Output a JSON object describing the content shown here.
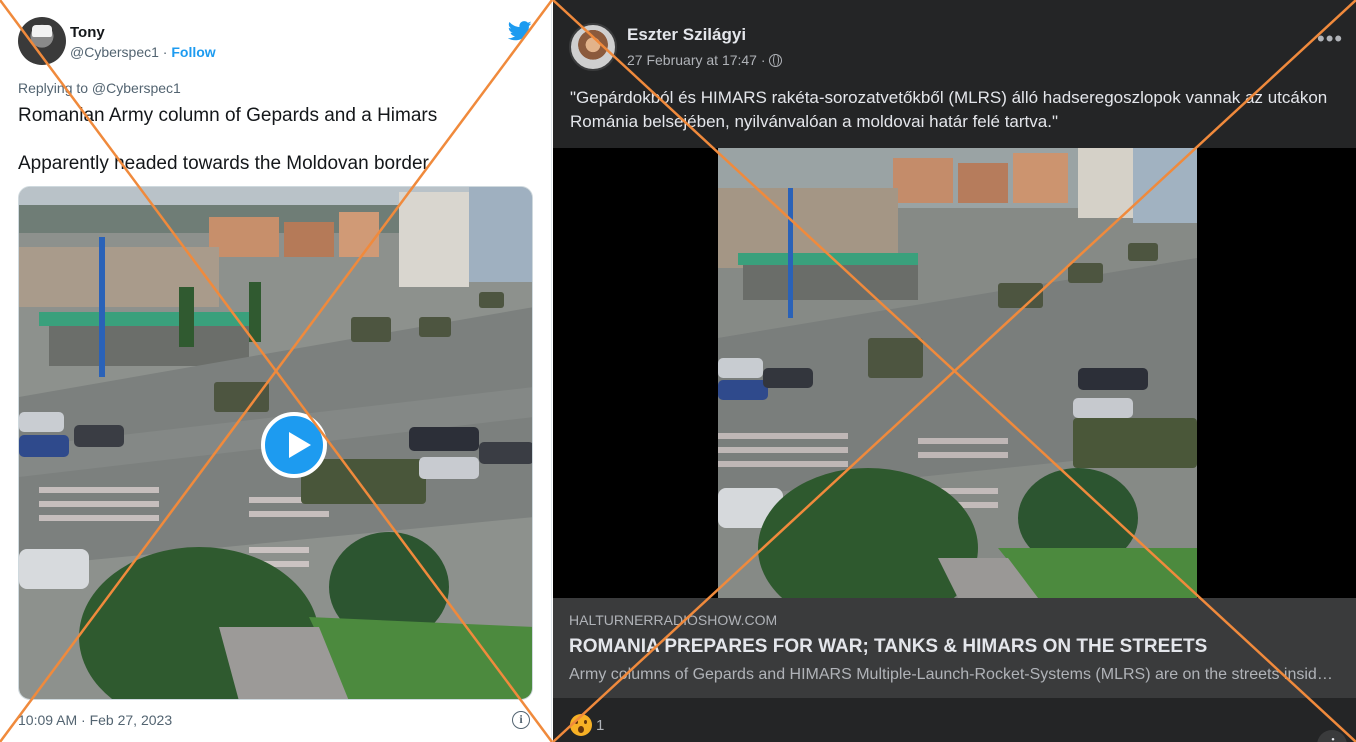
{
  "tweet": {
    "display_name": "Tony",
    "handle": "@Cyberspec1",
    "separator": " · ",
    "follow_label": "Follow",
    "replying_to": "Replying to @Cyberspec1",
    "text_line1": "Romanian Army column of Gepards and a Himars",
    "text_line2": "Apparently headed towards the Moldovan border",
    "timestamp": "10:09 AM · Feb 27, 2023",
    "icons": [
      "twitter-bird-icon",
      "play-icon",
      "info-icon"
    ]
  },
  "facebook": {
    "author": "Eszter Szilágyi",
    "timestamp": "27 February at 17:47 ·",
    "post_text": "\"Gepárdokból és HIMARS rakéta-sorozatvetőkből (MLRS) álló hadseregoszlopok vannak az utcákon Románia belsejében, nyilvánvalóan a moldovai határ felé tartva.\"",
    "link_domain": "HALTURNERRADIOSHOW.COM",
    "link_headline": "ROMANIA PREPARES FOR WAR; TANKS & HIMARS ON THE STREETS",
    "link_description": "Army columns of Gepards and HIMARS Multiple-Launch-Rocket-Systems (MLRS) are on the streets inside Romania",
    "reaction_count": "1",
    "icons": [
      "globe-icon",
      "more-options-icon",
      "info-icon",
      "wow-reaction-icon"
    ]
  },
  "colors": {
    "twitter_blue": "#1d9bf0",
    "facebook_dark": "#242526",
    "cross_orange": "#f08a3c"
  }
}
